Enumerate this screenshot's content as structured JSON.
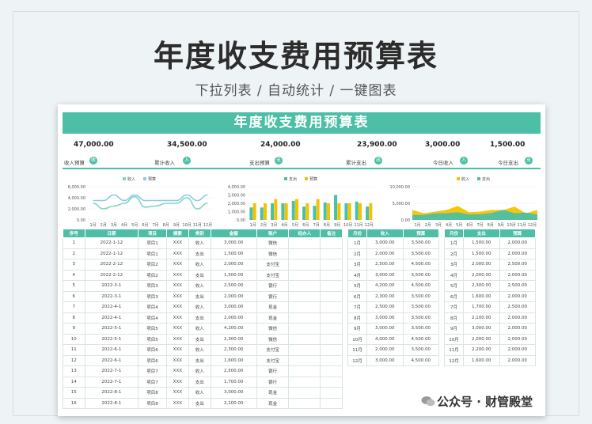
{
  "hero": {
    "title": "年度收支费用预算表",
    "subtitle": "下拉列表 /  自动统计  /  一键图表"
  },
  "sheet": {
    "banner": "年度收支费用预算表",
    "kpis": [
      {
        "value": "47,000.00",
        "label": "收入预算",
        "icon": "收"
      },
      {
        "value": "34,500.00",
        "label": "累计收入",
        "icon": "入"
      },
      {
        "value": "24,000.00",
        "label": "支出预算",
        "icon": "支"
      },
      {
        "value": "23,900.00",
        "label": "累计支出",
        "icon": "出"
      },
      {
        "value": "3,000.00",
        "label": "今日收入",
        "icon": "入"
      },
      {
        "value": "1,500.00",
        "label": "今日支出",
        "icon": "支"
      }
    ],
    "ledger": {
      "headers": [
        "序号",
        "日期",
        "项目",
        "摘要",
        "类别",
        "金额",
        "账户",
        "经办人",
        "备注"
      ],
      "rows": [
        [
          "1",
          "2022-1-12",
          "项目1",
          "XXX",
          "收入",
          "3,000.00",
          "微信",
          "",
          ""
        ],
        [
          "2",
          "2022-1-12",
          "项目1",
          "XXX",
          "支出",
          "1,500.00",
          "微信",
          "",
          ""
        ],
        [
          "3",
          "2022-2-12",
          "项目2",
          "XXX",
          "收入",
          "2,000.00",
          "支付宝",
          "",
          ""
        ],
        [
          "4",
          "2022-2-12",
          "项目2",
          "XXX",
          "支出",
          "1,500.00",
          "支付宝",
          "",
          ""
        ],
        [
          "5",
          "2022-3-1",
          "项目3",
          "XXX",
          "收入",
          "2,500.00",
          "银行",
          "",
          ""
        ],
        [
          "6",
          "2022-3-1",
          "项目3",
          "XXX",
          "支出",
          "2,000.00",
          "银行",
          "",
          ""
        ],
        [
          "7",
          "2022-4-1",
          "项目4",
          "XXX",
          "收入",
          "3,000.00",
          "现金",
          "",
          ""
        ],
        [
          "8",
          "2022-4-1",
          "项目4",
          "XXX",
          "支出",
          "2,000.00",
          "现金",
          "",
          ""
        ],
        [
          "9",
          "2022-5-1",
          "项目5",
          "XXX",
          "收入",
          "4,200.00",
          "微信",
          "",
          ""
        ],
        [
          "10",
          "2022-5-1",
          "项目5",
          "XXX",
          "支出",
          "2,300.00",
          "微信",
          "",
          ""
        ],
        [
          "11",
          "2022-6-1",
          "项目6",
          "XXX",
          "收入",
          "2,300.00",
          "支付宝",
          "",
          ""
        ],
        [
          "12",
          "2022-6-1",
          "项目6",
          "XXX",
          "支出",
          "1,600.00",
          "支付宝",
          "",
          ""
        ],
        [
          "13",
          "2022-7-1",
          "项目7",
          "XXX",
          "收入",
          "2,500.00",
          "银行",
          "",
          ""
        ],
        [
          "14",
          "2022-7-1",
          "项目7",
          "XXX",
          "支出",
          "1,700.00",
          "银行",
          "",
          ""
        ],
        [
          "15",
          "2022-8-1",
          "项目8",
          "XXX",
          "收入",
          "3,000.00",
          "现金",
          "",
          ""
        ],
        [
          "16",
          "2022-8-1",
          "项目8",
          "XXX",
          "支出",
          "2,100.00",
          "现金",
          "",
          ""
        ]
      ]
    },
    "income_table": {
      "headers": [
        "月份",
        "收入",
        "预算"
      ],
      "rows": [
        [
          "1月",
          "3,000.00",
          "3,500.00"
        ],
        [
          "2月",
          "2,000.00",
          "3,500.00"
        ],
        [
          "3月",
          "2,500.00",
          "4,500.00"
        ],
        [
          "4月",
          "3,000.00",
          "3,500.00"
        ],
        [
          "5月",
          "4,200.00",
          "4,500.00"
        ],
        [
          "6月",
          "2,300.00",
          "3,500.00"
        ],
        [
          "7月",
          "2,500.00",
          "3,500.00"
        ],
        [
          "8月",
          "3,000.00",
          "3,500.00"
        ],
        [
          "9月",
          "3,000.00",
          "3,500.00"
        ],
        [
          "10月",
          "4,000.00",
          "4,500.00"
        ],
        [
          "11月",
          "2,000.00",
          "3,500.00"
        ],
        [
          "12月",
          "3,000.00",
          "4,500.00"
        ]
      ]
    },
    "expense_table": {
      "headers": [
        "月份",
        "支出",
        "预算"
      ],
      "rows": [
        [
          "1月",
          "1,500.00",
          "2,000.00"
        ],
        [
          "2月",
          "1,500.00",
          "2,000.00"
        ],
        [
          "3月",
          "2,000.00",
          "2,500.00"
        ],
        [
          "4月",
          "2,000.00",
          "2,000.00"
        ],
        [
          "5月",
          "2,300.00",
          "2,500.00"
        ],
        [
          "6月",
          "1,600.00",
          "2,000.00"
        ],
        [
          "7月",
          "1,700.00",
          "2,500.00"
        ],
        [
          "8月",
          "2,100.00",
          "2,000.00"
        ],
        [
          "9月",
          "3,000.00",
          "2,000.00"
        ],
        [
          "10月",
          "2,000.00",
          "2,000.00"
        ],
        [
          "11月",
          "2,200.00",
          "2,000.00"
        ],
        [
          "12月",
          "1,600.00",
          "2,000.00"
        ]
      ]
    }
  },
  "colors": {
    "accent": "#4cbfa6",
    "yellow": "#f3c300",
    "line_green": "#7fd6c3",
    "line_blue": "#8cc9ee"
  },
  "chart_data": [
    {
      "type": "line",
      "categories": [
        "1月",
        "2月",
        "3月",
        "4月",
        "5月",
        "6月",
        "7月",
        "8月",
        "9月",
        "10月",
        "11月",
        "12月"
      ],
      "series": [
        {
          "name": "收入",
          "values": [
            3000,
            2000,
            2500,
            3000,
            4200,
            2300,
            2500,
            3000,
            3000,
            4000,
            2000,
            3000
          ]
        },
        {
          "name": "预算",
          "values": [
            3500,
            3500,
            4500,
            3500,
            4500,
            3500,
            3500,
            3500,
            3500,
            4500,
            3500,
            4500
          ]
        }
      ],
      "yticks": [
        "6,000.00",
        "4,000.00",
        "2,000.00",
        "0.00"
      ],
      "ylim": [
        0,
        6000
      ],
      "legend": "top"
    },
    {
      "type": "bar",
      "categories": [
        "1月",
        "2月",
        "3月",
        "4月",
        "5月",
        "6月",
        "7月",
        "8月",
        "9月",
        "10月",
        "11月",
        "12月"
      ],
      "series": [
        {
          "name": "支出",
          "values": [
            1500,
            1500,
            2000,
            2000,
            2300,
            1600,
            1700,
            2100,
            3000,
            2000,
            2200,
            1600
          ]
        },
        {
          "name": "预算",
          "values": [
            2000,
            2000,
            2500,
            2000,
            2500,
            2000,
            2500,
            2000,
            2000,
            2000,
            2000,
            2000
          ]
        }
      ],
      "yticks": [
        "4,000.00",
        "3,000.00",
        "2,000.00",
        "1,000.00",
        "0.00"
      ],
      "ylim": [
        0,
        4000
      ],
      "legend": "top"
    },
    {
      "type": "area",
      "categories": [
        "1月",
        "2月",
        "3月",
        "4月",
        "5月",
        "6月",
        "7月",
        "8月",
        "9月",
        "10月",
        "11月",
        "12月"
      ],
      "series": [
        {
          "name": "收入",
          "values": [
            3000,
            2000,
            2500,
            3000,
            4200,
            2300,
            2500,
            3000,
            3000,
            4000,
            2000,
            3000
          ]
        },
        {
          "name": "支出",
          "values": [
            1500,
            1500,
            2000,
            2000,
            2300,
            1600,
            1700,
            2100,
            3000,
            2000,
            2200,
            1600
          ]
        }
      ],
      "yticks": [
        "10,000.00",
        "5,000.00",
        "0.00"
      ],
      "ylim": [
        0,
        10000
      ],
      "legend": "top"
    }
  ],
  "watermark": "公众号 · 财管殿堂"
}
